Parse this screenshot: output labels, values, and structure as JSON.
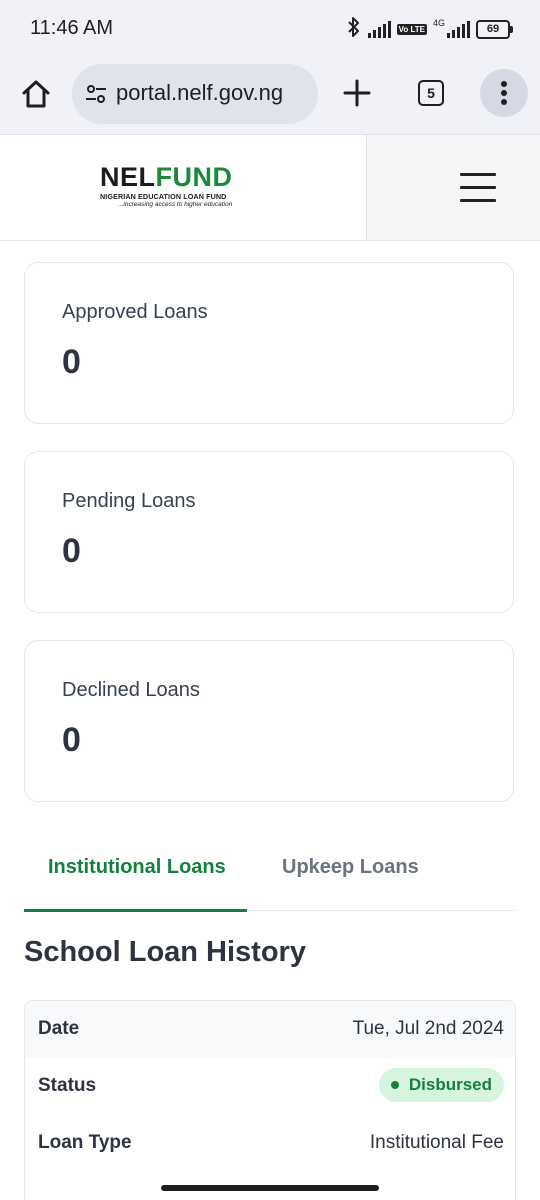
{
  "status_bar": {
    "time": "11:46 AM",
    "volte_label": "Vo LTE",
    "network_label": "4G",
    "battery": "69"
  },
  "browser": {
    "url": "portal.nelf.gov.ng",
    "tab_count": "5"
  },
  "site": {
    "logo_nel": "NEL",
    "logo_fund": "FUND",
    "logo_sub": "NIGERIAN EDUCATION LOAN FUND",
    "logo_tagline": "...increasing access to higher education"
  },
  "stats": [
    {
      "label": "Approved Loans",
      "value": "0"
    },
    {
      "label": "Pending Loans",
      "value": "0"
    },
    {
      "label": "Declined Loans",
      "value": "0"
    }
  ],
  "tabs": [
    {
      "label": "Institutional Loans",
      "active": true
    },
    {
      "label": "Upkeep Loans",
      "active": false
    }
  ],
  "history": {
    "title": "School Loan History",
    "rows": [
      {
        "key": "Date",
        "value": "Tue, Jul 2nd 2024"
      },
      {
        "key": "Status",
        "value": "Disbursed"
      },
      {
        "key": "Loan Type",
        "value": "Institutional Fee"
      }
    ]
  },
  "colors": {
    "accent_green": "#15803d",
    "badge_bg": "#d7f5de",
    "card_border": "#e5e7eb",
    "chrome_bg": "#f1f2f7"
  }
}
